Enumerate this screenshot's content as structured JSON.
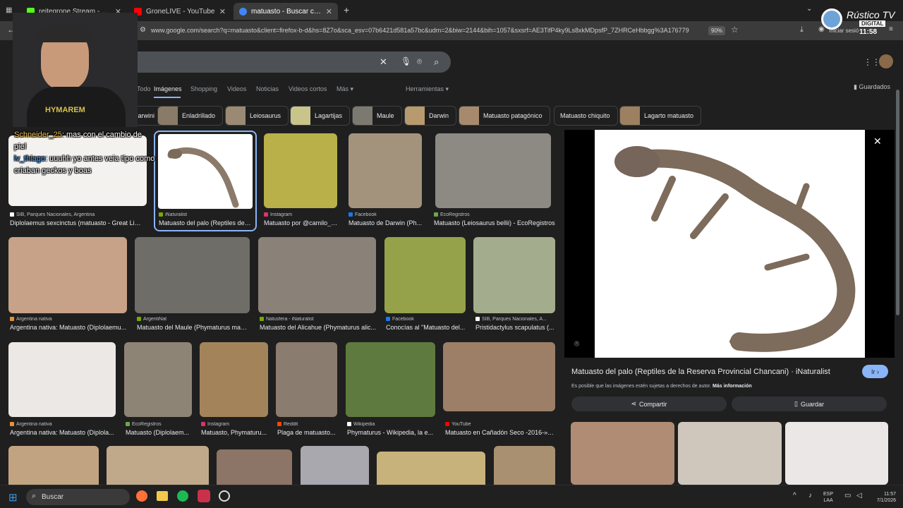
{
  "tabs": [
    {
      "title": "reitegrone Stream - Watch Live",
      "fav_color": "#53fc18"
    },
    {
      "title": "GroneLIVE - YouTube",
      "fav_color": "#ff0000"
    },
    {
      "title": "matuasto - Buscar con Google",
      "fav_color": "#4285f4"
    }
  ],
  "browser": {
    "url": "www.google.com/search?q=matuasto&client=firefox-b-d&hs=8Z7o&sca_esv=07b6421d581a57bc&udm=2&biw=2144&bih=1057&sxsrf=AE3TifP4ky9Ls8xkMDpsfP_7ZHRCeHbbgg%3A176779",
    "zoom": "90%",
    "signin": "Iniciar sesió"
  },
  "google": {
    "nav": [
      "Todo",
      "Imágenes",
      "Shopping",
      "Videos",
      "Noticias",
      "Videos cortos",
      "Más ▾",
      "Herramientas ▾"
    ],
    "saved": "Guardados",
    "chips": [
      "Darwini",
      "Enladrillado",
      "Leiosaurus",
      "Lagartijas",
      "Maule",
      "Darwin",
      "Matuasto patagónico",
      "Matuasto chiquito",
      "Lagarto matuasto"
    ]
  },
  "results": [
    {
      "source": "SIB, Parques Nacionales, Argentina",
      "title": "Diplolaemus sexcinctus (matuasto - Great Lizar...",
      "icolor": "#ffffff"
    },
    {
      "source": "iNaturalist",
      "title": "Matuasto del palo (Reptiles de l...",
      "icolor": "#74ac00"
    },
    {
      "source": "Instagram",
      "title": "Matuasto por @camilo_s...",
      "icolor": "#e1306c"
    },
    {
      "source": "Facebook",
      "title": "Matuasto de Darwin (Ph...",
      "icolor": "#1877f2"
    },
    {
      "source": "EcoRegistros",
      "title": "Matuasto (Leiosaurus bellii) - EcoRegistros",
      "icolor": "#6aa84f"
    },
    {
      "source": "Argentina nativa",
      "title": "Argentina nativa: Matuasto (Diplolaemu...",
      "icolor": "#e69138"
    },
    {
      "source": "ArgentiNat",
      "title": "Matuasto del Maule (Phymaturus maul...",
      "icolor": "#74ac00"
    },
    {
      "source": "Natusfera - iNaturalist",
      "title": "Matuasto del Alicahue (Phymaturus alic...",
      "icolor": "#74ac00"
    },
    {
      "source": "Facebook",
      "title": "Conocías al \"Matuasto del...",
      "icolor": "#1877f2"
    },
    {
      "source": "SIB, Parques Nacionales, A...",
      "title": "Pristidactylus scapulatus (...",
      "icolor": "#ffffff"
    },
    {
      "source": "Argentina nativa",
      "title": "Argentina nativa: Matuasto (Diplola...",
      "icolor": "#e69138"
    },
    {
      "source": "EcoRegistros",
      "title": "Matuasto (Diplolaem...",
      "icolor": "#6aa84f"
    },
    {
      "source": "Instagram",
      "title": "Matuasto, Phymaturu...",
      "icolor": "#e1306c"
    },
    {
      "source": "Reddit",
      "title": "Plaga de matuasto...",
      "icolor": "#ff4500"
    },
    {
      "source": "Wikipedia",
      "title": "Phymaturus - Wikipedia, la e...",
      "icolor": "#ffffff"
    },
    {
      "source": "YouTube",
      "title": "Matuasto en Cañadón Seco -2016-» -...",
      "icolor": "#ff0000"
    }
  ],
  "panel": {
    "title": "Matuasto del palo (Reptiles de la Reserva Provincial Chancani) · iNaturalist",
    "go": "Ir ›",
    "note": "Es posible que las imágenes estén sujetas a derechos de autor.",
    "more_info": "Más información",
    "share": "Compartir",
    "save": "Guardar"
  },
  "stream": {
    "chat": [
      {
        "user": "Schneider_25",
        "msg": ": mas con el cambio de piel"
      },
      {
        "user": "lv_thiago",
        "msg": ": uuuhh yo antes veia tipo como criaban geckos y boas"
      }
    ],
    "shirt": "HYMAREM",
    "logo": "Rústico TV",
    "logo_sub": "DIGITAL",
    "clock": "11:58"
  },
  "taskbar": {
    "search": "Buscar",
    "lang1": "ESP",
    "lang2": "LAA",
    "time": "11:57",
    "date": "7/1/2026"
  }
}
